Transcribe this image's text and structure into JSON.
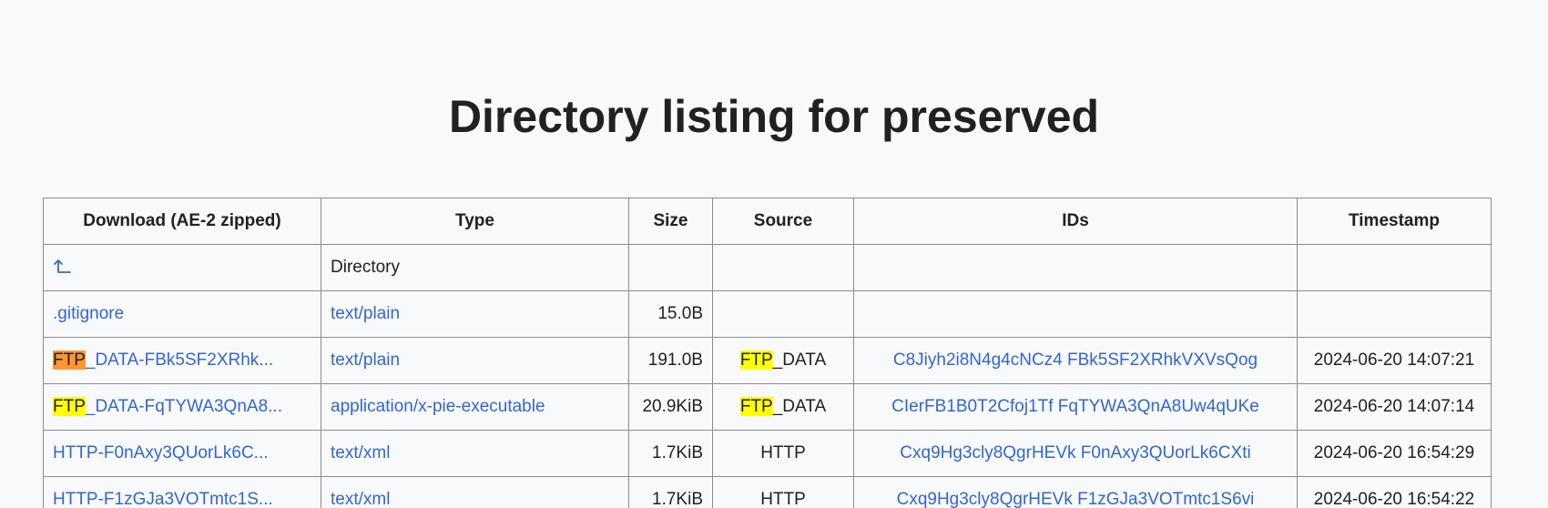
{
  "page": {
    "title": "Directory listing for preserved"
  },
  "table": {
    "headers": [
      "Download (AE-2 zipped)",
      "Type",
      "Size",
      "Source",
      "IDs",
      "Timestamp"
    ],
    "parent_row": {
      "icon": "up-arrow-icon",
      "type": "Directory"
    },
    "rows": [
      {
        "name_highlight": "",
        "name_rest": ".gitignore",
        "type": "text/plain",
        "size": "15.0B",
        "source_highlight": "",
        "source_rest": "",
        "ids": "",
        "timestamp": ""
      },
      {
        "name_highlight": "FTP",
        "name_rest": "_DATA-FBk5SF2XRhk...",
        "type": "text/plain",
        "size": "191.0B",
        "source_highlight": "FTP",
        "source_rest": "_DATA",
        "ids": "C8Jiyh2i8N4g4cNCz4 FBk5SF2XRhkVXVsQog",
        "timestamp": "2024-06-20 14:07:21"
      },
      {
        "name_highlight": "FTP",
        "name_rest": "_DATA-FqTYWA3QnA8...",
        "type": "application/x-pie-executable",
        "size": "20.9KiB",
        "source_highlight": "FTP",
        "source_rest": "_DATA",
        "ids": "CIerFB1B0T2Cfoj1Tf FqTYWA3QnA8Uw4qUKe",
        "timestamp": "2024-06-20 14:07:14"
      },
      {
        "name_highlight": "",
        "name_rest": "HTTP-F0nAxy3QUorLk6C...",
        "type": "text/xml",
        "size": "1.7KiB",
        "source_highlight": "",
        "source_rest": "HTTP",
        "ids": "Cxq9Hg3cly8QgrHEVk F0nAxy3QUorLk6CXti",
        "timestamp": "2024-06-20 16:54:29"
      },
      {
        "name_highlight": "",
        "name_rest": "HTTP-F1zGJa3VOTmtc1S...",
        "type": "text/xml",
        "size": "1.7KiB",
        "source_highlight": "",
        "source_rest": "HTTP",
        "ids": "Cxq9Hg3cly8QgrHEVk F1zGJa3VOTmtc1S6vi",
        "timestamp": "2024-06-20 16:54:22"
      }
    ]
  },
  "colors": {
    "link": "#3366cc",
    "highlight": "#ffff00",
    "highlight_active": "#ff9632",
    "border": "#8a8d91",
    "background": "#f8f9fa"
  }
}
